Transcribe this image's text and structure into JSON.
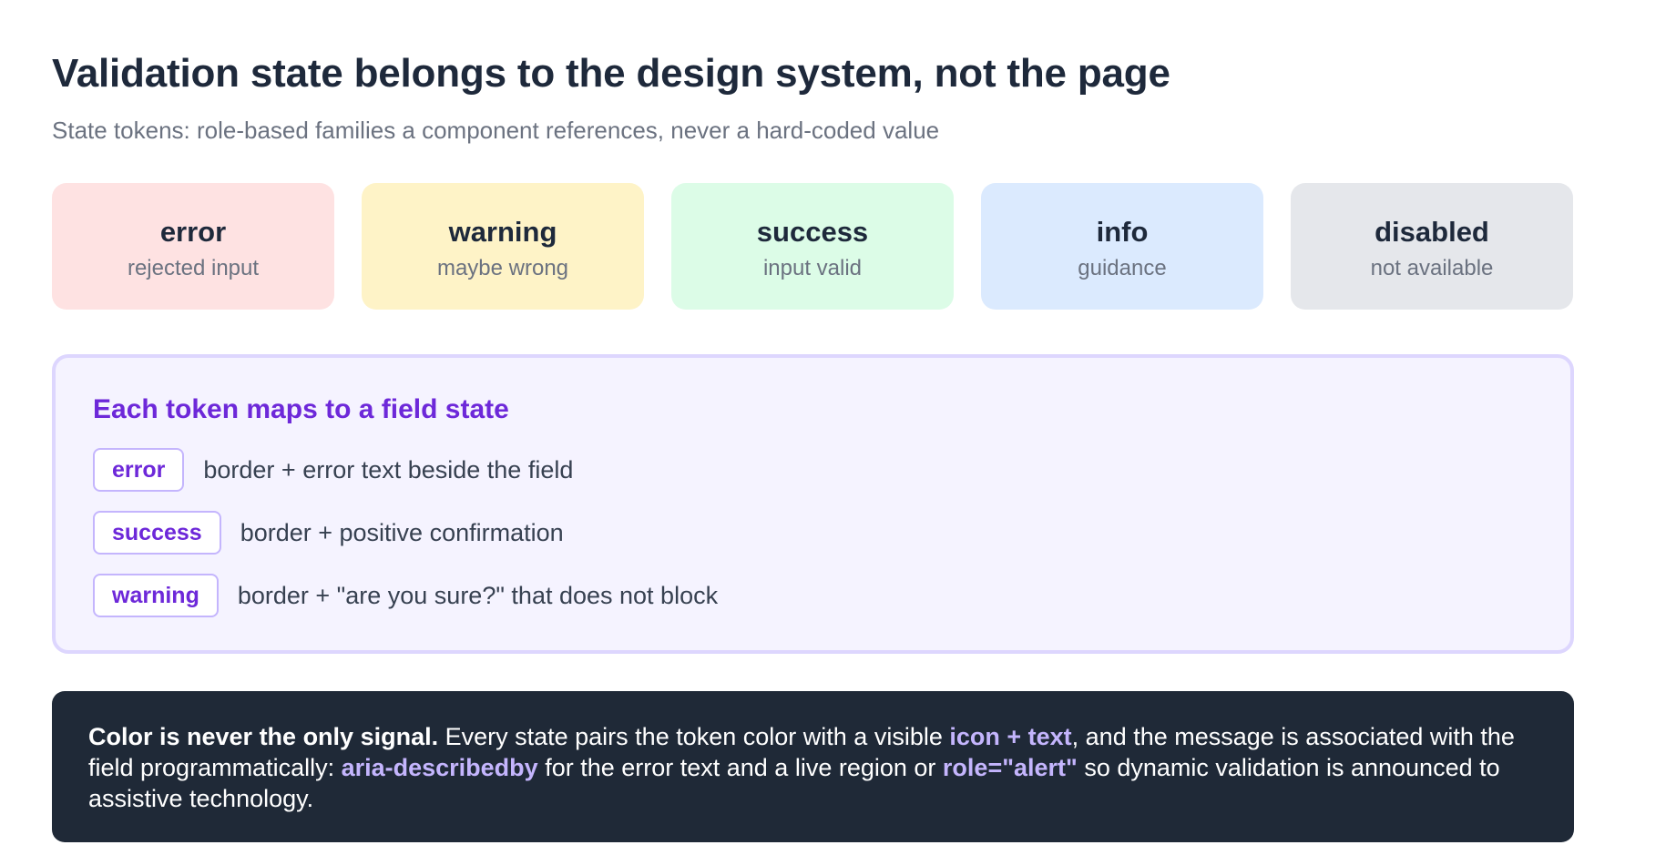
{
  "header": {
    "title": "Validation state belongs to the design system, not the page",
    "subtitle": "State tokens: role-based families a component references, never a hard-coded value"
  },
  "tokens": [
    {
      "name": "error",
      "description": "rejected input",
      "color": "#fee2e2"
    },
    {
      "name": "warning",
      "description": "maybe wrong",
      "color": "#fef3c7"
    },
    {
      "name": "success",
      "description": "input valid",
      "color": "#dcfce7"
    },
    {
      "name": "info",
      "description": "guidance",
      "color": "#dbeafe"
    },
    {
      "name": "disabled",
      "description": "not available",
      "color": "#e5e7eb"
    }
  ],
  "mapping": {
    "title": "Each token maps to a field state",
    "rows": [
      {
        "token": "error",
        "description": "border + error text beside the field"
      },
      {
        "token": "success",
        "description": "border + positive confirmation"
      },
      {
        "token": "warning",
        "description": "border + \"are you sure?\" that does not block"
      }
    ]
  },
  "note": {
    "lead": "Color is never the only signal.",
    "text_1": " Every state pairs the token color with a visible ",
    "highlight_1": "icon + text",
    "text_2": ", and the message is associated with the field programmatically: ",
    "highlight_2": "aria-describedby",
    "text_3": " for the error text and a live region or ",
    "highlight_3": "role=\"alert\"",
    "text_4": " so dynamic validation is announced to assistive technology."
  },
  "colors": {
    "accent": "#6d28d9",
    "accent_light": "#c4b5fd",
    "panel_bg": "#f5f3ff",
    "dark_bg": "#1f2937"
  }
}
